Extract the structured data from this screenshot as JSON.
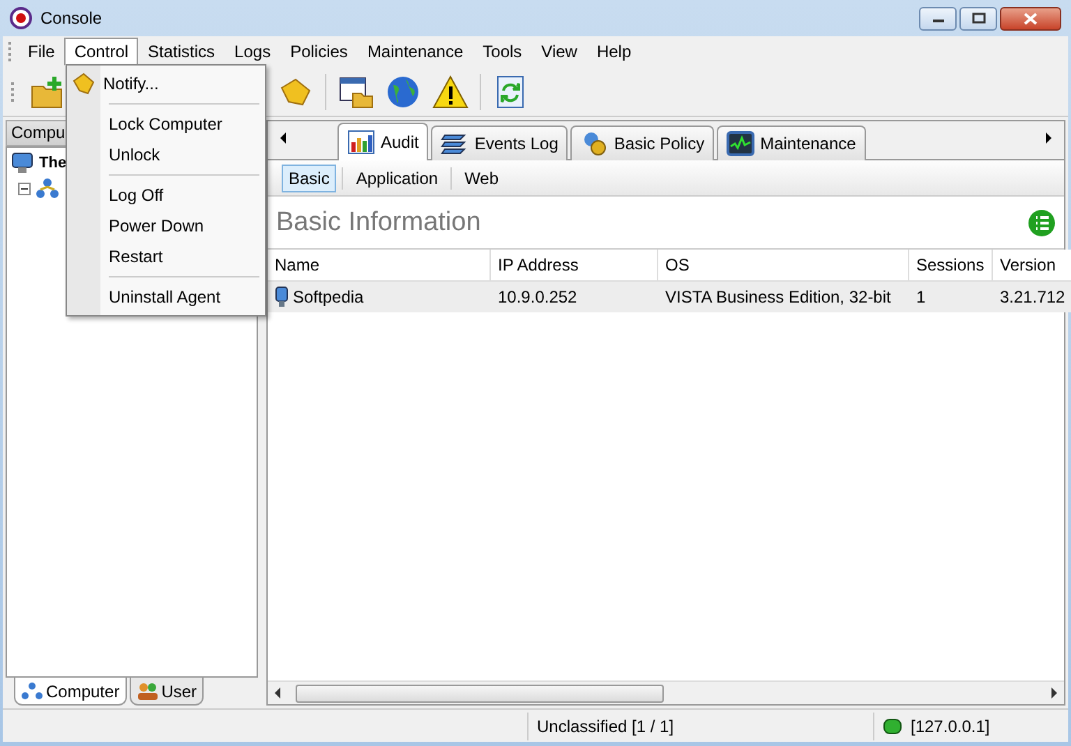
{
  "window": {
    "title": "Console"
  },
  "menu_bar": [
    {
      "label": "File",
      "selected": false
    },
    {
      "label": "Control",
      "selected": true
    },
    {
      "label": "Statistics",
      "selected": false
    },
    {
      "label": "Logs",
      "selected": false
    },
    {
      "label": "Policies",
      "selected": false
    },
    {
      "label": "Maintenance",
      "selected": false
    },
    {
      "label": "Tools",
      "selected": false
    },
    {
      "label": "View",
      "selected": false
    },
    {
      "label": "Help",
      "selected": false
    }
  ],
  "dropdown": [
    {
      "kind": "item",
      "label": "Notify..."
    },
    {
      "kind": "separator"
    },
    {
      "kind": "item",
      "label": "Lock Computer"
    },
    {
      "kind": "item",
      "label": "Unlock"
    },
    {
      "kind": "separator"
    },
    {
      "kind": "item",
      "label": "Log Off"
    },
    {
      "kind": "item",
      "label": "Power Down"
    },
    {
      "kind": "item",
      "label": "Restart"
    },
    {
      "kind": "separator"
    },
    {
      "kind": "item",
      "label": "Uninstall Agent"
    }
  ],
  "sidebar": {
    "header": "Compu",
    "tree": [
      {
        "label": "The",
        "expanded": true,
        "children": [
          {
            "expanded": true
          }
        ]
      }
    ],
    "bottom_tabs": [
      {
        "label": "Computer",
        "selected": true
      },
      {
        "label": "User",
        "selected": false
      }
    ]
  },
  "tabs": [
    {
      "label": "Audit",
      "selected": true
    },
    {
      "label": "Events Log",
      "selected": false
    },
    {
      "label": "Basic Policy",
      "selected": false
    },
    {
      "label": "Maintenance",
      "selected": false
    }
  ],
  "subtabs": [
    {
      "label": "Basic",
      "selected": true
    },
    {
      "label": "Application",
      "selected": false
    },
    {
      "label": "Web",
      "selected": false
    }
  ],
  "section_title": "Basic Information",
  "table": {
    "columns": [
      "Name",
      "IP Address",
      "OS",
      "Sessions",
      "Version"
    ],
    "rows": [
      [
        "Softpedia",
        "10.9.0.252",
        "VISTA Business Edition, 32-bit",
        "1",
        "3.21.712"
      ]
    ]
  },
  "status_bar": {
    "classification": "Unclassified [1 / 1]",
    "address": "[127.0.0.1]"
  }
}
